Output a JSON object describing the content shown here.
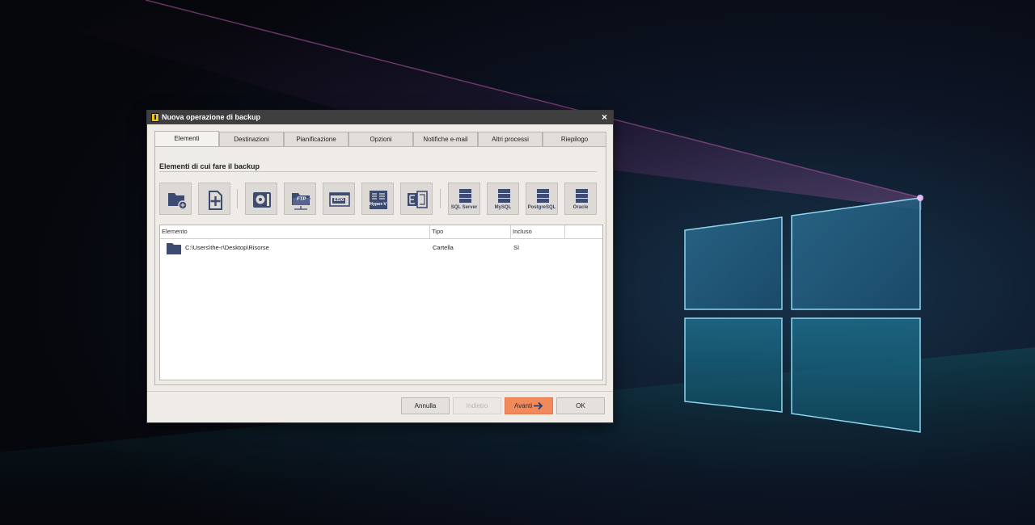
{
  "window": {
    "title": "Nuova operazione di backup",
    "close_glyph": "×"
  },
  "tabs": [
    {
      "label": "Elementi",
      "active": true
    },
    {
      "label": "Destinazioni",
      "active": false
    },
    {
      "label": "Pianificazione",
      "active": false
    },
    {
      "label": "Opzioni",
      "active": false
    },
    {
      "label": "Notifiche e-mail",
      "active": false
    },
    {
      "label": "Altri processi",
      "active": false
    },
    {
      "label": "Riepilogo",
      "active": false
    }
  ],
  "section": {
    "title": "Elementi di cui fare il backup"
  },
  "toolbar": {
    "buttons": [
      {
        "icon": "add-folder-icon",
        "label": ""
      },
      {
        "icon": "add-file-icon",
        "label": ""
      },
      {
        "icon": "disk-image-icon",
        "label": ""
      },
      {
        "icon": "ftp-folder-icon",
        "label": ""
      },
      {
        "icon": "esxi-icon",
        "label": ""
      },
      {
        "icon": "hyper-v-icon",
        "label": ""
      },
      {
        "icon": "exchange-icon",
        "label": ""
      },
      {
        "icon": "database-icon",
        "label": "SQL Server"
      },
      {
        "icon": "database-icon",
        "label": "MySQL"
      },
      {
        "icon": "database-icon",
        "label": "PostgreSQL"
      },
      {
        "icon": "database-icon",
        "label": "Oracle"
      }
    ],
    "small_labels": {
      "ftp": "FTP",
      "esxi": "ESXi",
      "hyperv": "Hyper-V"
    }
  },
  "table": {
    "columns": [
      "Elemento",
      "Tipo",
      "Incluso"
    ],
    "rows": [
      {
        "icon": "folder-icon",
        "element": "C:\\Users\\the-r\\Desktop\\Risorse",
        "type": "Cartella",
        "included": "Sì"
      }
    ]
  },
  "footer": {
    "cancel": "Annulla",
    "back": "Indietro",
    "next": "Avanti",
    "ok": "OK"
  },
  "colors": {
    "accent": "#f08a5b",
    "icon_blue": "#3d4a72",
    "titlebar": "#3f3f3f"
  }
}
